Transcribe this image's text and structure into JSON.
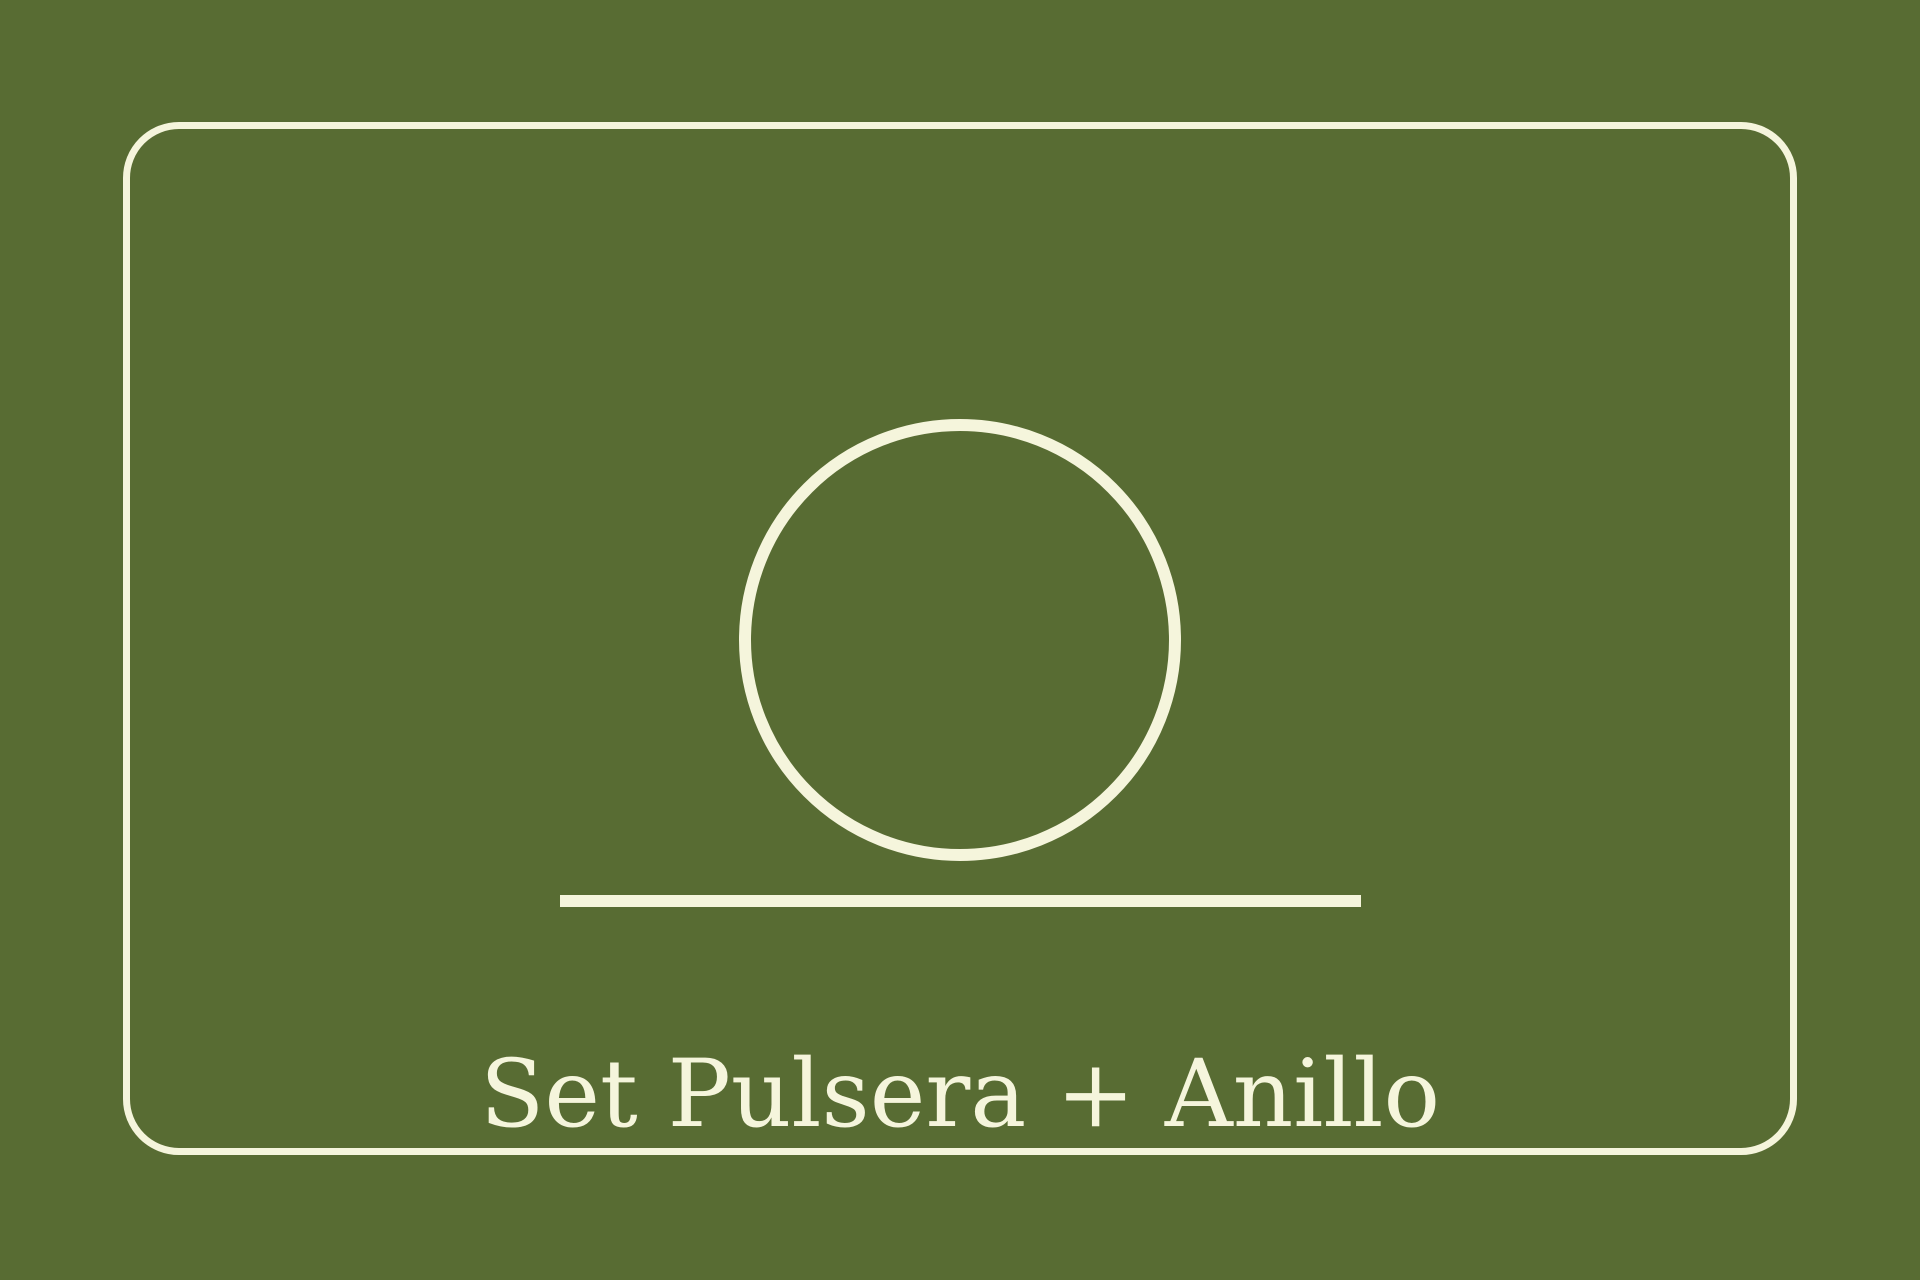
{
  "colors": {
    "background": "#586c33",
    "foreground": "#f5f5dc"
  },
  "product": {
    "icon": "ring-on-line-icon",
    "title": "Set Pulsera + Anillo"
  }
}
